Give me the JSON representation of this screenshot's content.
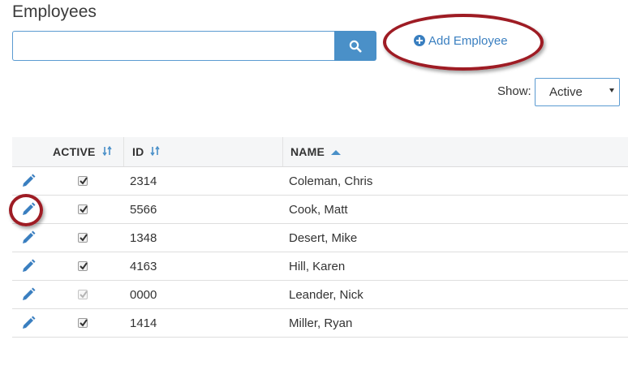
{
  "page": {
    "title": "Employees"
  },
  "search": {
    "value": "",
    "placeholder": "",
    "button_icon": "search-icon"
  },
  "add_employee": {
    "label": "Add Employee",
    "icon": "plus-circle-icon"
  },
  "filter": {
    "label": "Show:",
    "selected": "Active"
  },
  "table": {
    "columns": [
      {
        "key": "active",
        "label": "ACTIVE",
        "sort": "none"
      },
      {
        "key": "id",
        "label": "ID",
        "sort": "none"
      },
      {
        "key": "name",
        "label": "NAME",
        "sort": "ascending"
      }
    ],
    "rows": [
      {
        "active": true,
        "disabled": false,
        "id": "2314",
        "name": "Coleman, Chris"
      },
      {
        "active": true,
        "disabled": false,
        "id": "5566",
        "name": "Cook, Matt"
      },
      {
        "active": true,
        "disabled": false,
        "id": "1348",
        "name": "Desert, Mike"
      },
      {
        "active": true,
        "disabled": false,
        "id": "4163",
        "name": "Hill, Karen"
      },
      {
        "active": true,
        "disabled": true,
        "id": "0000",
        "name": "Leander, Nick"
      },
      {
        "active": true,
        "disabled": false,
        "id": "1414",
        "name": "Miller, Ryan"
      }
    ]
  },
  "colors": {
    "accent": "#3a7fc0",
    "button": "#4a90c8",
    "annotation": "#9e1c24",
    "header_bg": "#f5f6f7"
  }
}
